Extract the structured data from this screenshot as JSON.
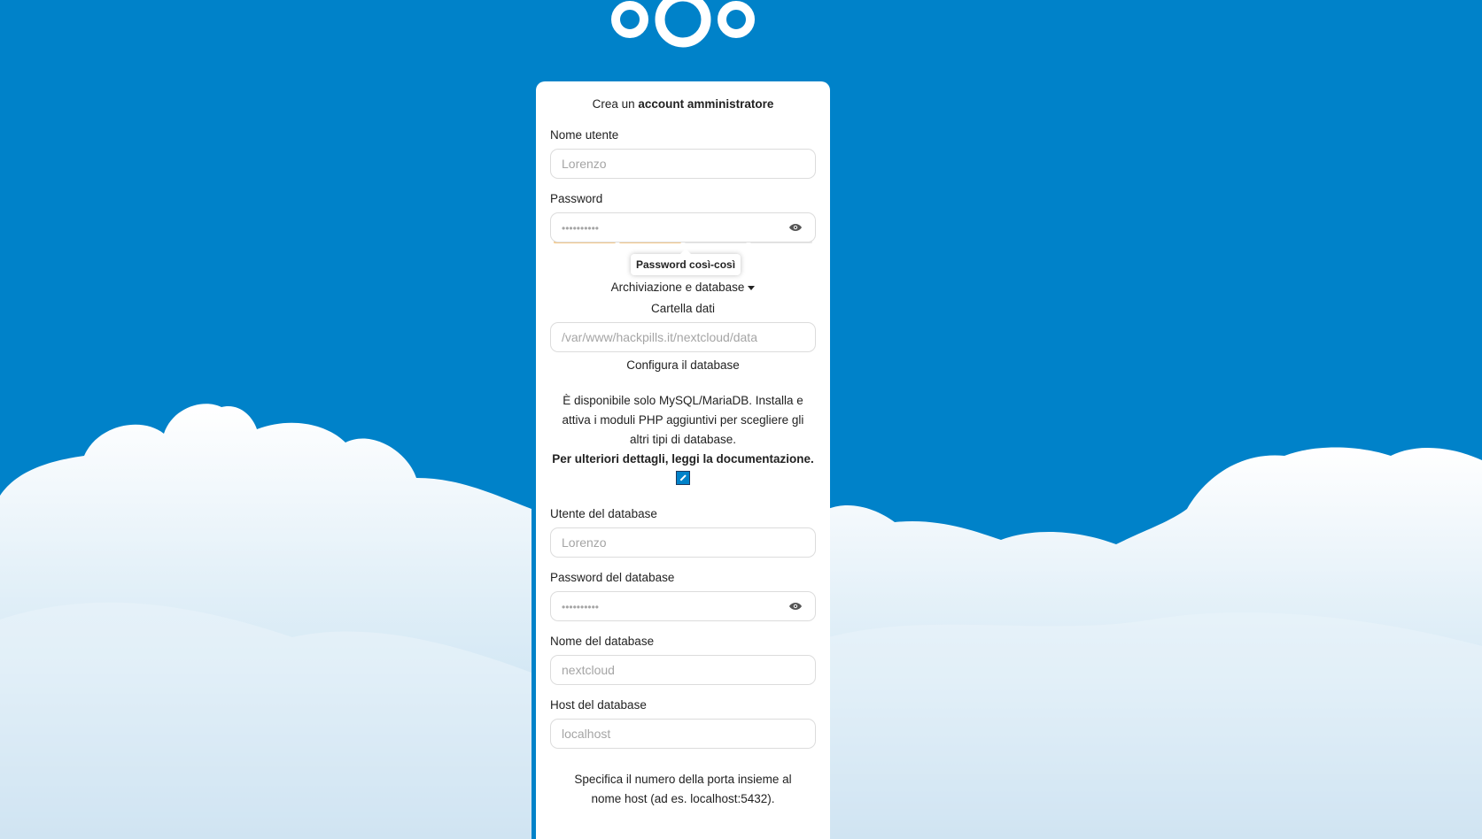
{
  "heading": {
    "prefix": "Crea un ",
    "bold": "account amministratore"
  },
  "username": {
    "label": "Nome utente",
    "placeholder": "Lorenzo"
  },
  "password": {
    "label": "Password",
    "placeholder": "••••••••••",
    "strength_tooltip": "Password così-così",
    "strength_level": 0.5
  },
  "storage": {
    "toggle": "Archiviazione e database",
    "data_folder_label": "Cartella dati",
    "data_folder_placeholder": "/var/www/hackpills.it/nextcloud/data",
    "configure_db": "Configura il database",
    "db_notice": "È disponibile solo MySQL/MariaDB. Installa e attiva i moduli PHP aggiuntivi per scegliere gli altri tipi di database.",
    "docs_link": "Per ulteriori dettagli, leggi la documentazione."
  },
  "db_user": {
    "label": "Utente del database",
    "placeholder": "Lorenzo"
  },
  "db_password": {
    "label": "Password del database",
    "placeholder": "••••••••••"
  },
  "db_name": {
    "label": "Nome del database",
    "placeholder": "nextcloud"
  },
  "db_host": {
    "label": "Host del database",
    "placeholder": "localhost"
  },
  "port_hint": "Specifica il numero della porta insieme al nome host (ad es. localhost:5432).",
  "colors": {
    "background": "#0082c9",
    "card": "#ffffff",
    "strength": "#f5c98a"
  }
}
